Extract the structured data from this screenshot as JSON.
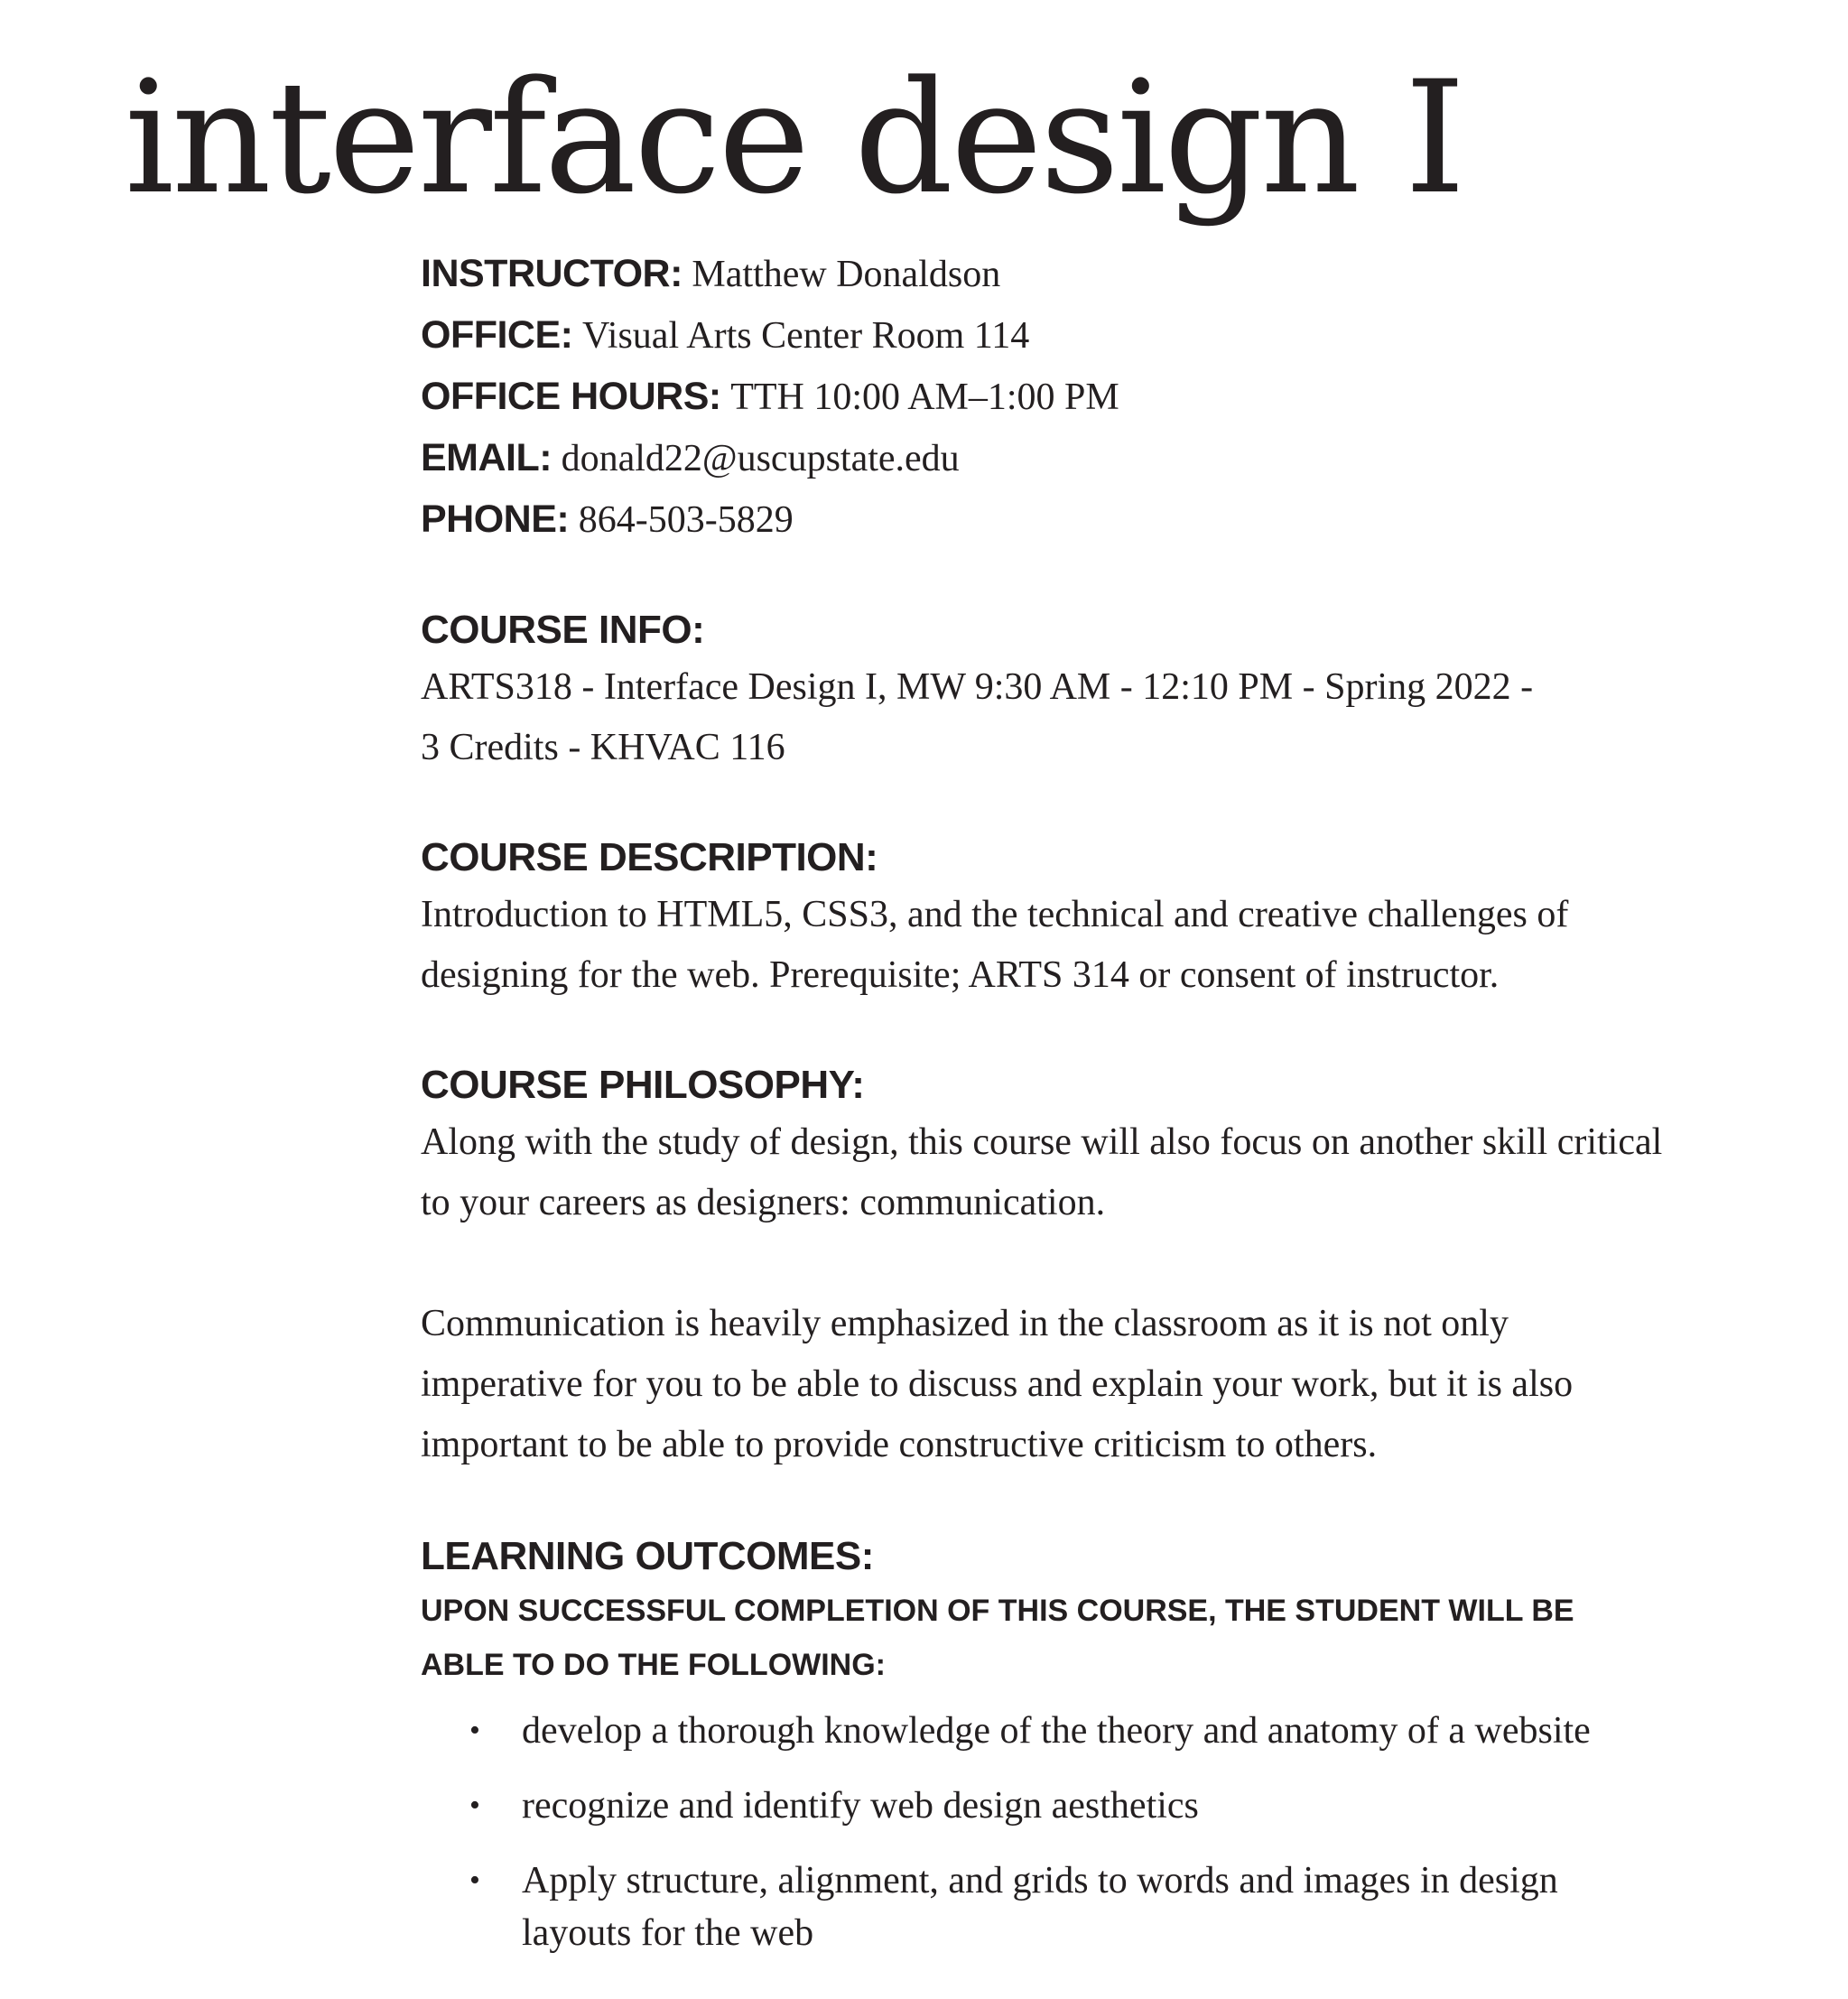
{
  "title": "interface design I",
  "contact": [
    {
      "label": "INSTRUCTOR:",
      "value": "Matthew Donaldson"
    },
    {
      "label": "OFFICE:",
      "value": "Visual Arts Center Room 114"
    },
    {
      "label": "OFFICE HOURS:",
      "value": "TTH 10:00 AM–1:00 PM"
    },
    {
      "label": "EMAIL:",
      "value": "donald22@uscupstate.edu"
    },
    {
      "label": "PHONE:",
      "value": "864-503-5829"
    }
  ],
  "course_info": {
    "heading": "COURSE INFO:",
    "line1": "ARTS318 - Interface Design I, MW 9:30 AM - 12:10 PM - Spring 2022 -",
    "line2": "3 Credits - KHVAC 116"
  },
  "course_description": {
    "heading": "COURSE DESCRIPTION:",
    "line1": "Introduction to HTML5, CSS3, and the technical and creative challenges of",
    "line2": "designing for the web. Prerequisite; ARTS 314 or consent of instructor."
  },
  "course_philosophy": {
    "heading": "COURSE PHILOSOPHY:",
    "p1_line1": "Along with the study of design, this course will also focus on another skill critical",
    "p1_line2": "to your careers as designers: communication.",
    "p2_line1": "Communication is heavily emphasized in the classroom as it is not only",
    "p2_line2": "imperative for you to be able to discuss and explain your work, but it is also",
    "p2_line3": "important to be able to provide constructive criticism to others."
  },
  "learning_outcomes": {
    "heading": "LEARNING OUTCOMES:",
    "subheading_line1": "UPON SUCCESSFUL COMPLETION OF THIS COURSE, THE STUDENT WILL BE",
    "subheading_line2": "ABLE TO DO THE FOLLOWING:",
    "bullet": "•",
    "items": [
      {
        "line1": "develop a thorough knowledge of the theory and anatomy of a website",
        "line2": ""
      },
      {
        "line1": "recognize and identify web design aesthetics",
        "line2": ""
      },
      {
        "line1": "Apply structure, alignment, and grids to words and images in design",
        "line2": "layouts for the web"
      }
    ]
  }
}
